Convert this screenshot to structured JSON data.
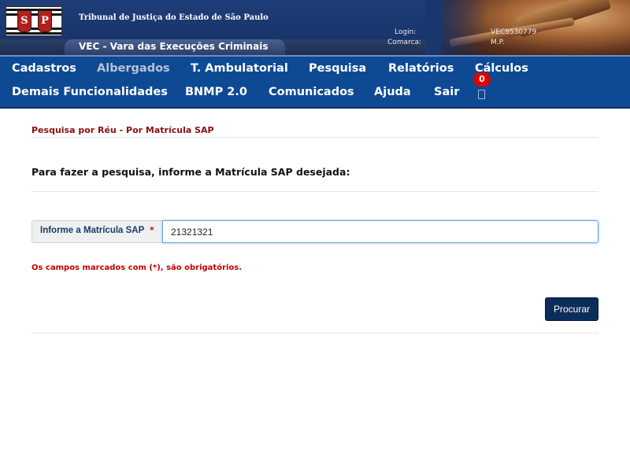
{
  "header": {
    "court_name": "Tribunal de Justiça do Estado de São Paulo",
    "system_name": "VEC - Vara das Execuções Criminais",
    "login_label": "Login:",
    "login_value": "VEC9530779",
    "comarca_label": "Comarca:",
    "comarca_value": "M.P.",
    "logo_letters": [
      "S",
      "P"
    ]
  },
  "nav": {
    "row1": [
      "Cadastros",
      "Albergados",
      "T. Ambulatorial",
      "Pesquisa",
      "Relatórios",
      "Cálculos"
    ],
    "row2": [
      "Demais Funcionalidades",
      "BNMP 2.0",
      "Comunicados",
      "Ajuda",
      "Sair"
    ],
    "disabled_item": "Albergados",
    "notification_count": "0",
    "notification_icon": "bell-icon"
  },
  "form": {
    "section_title": "Pesquisa por Réu - Por Matrícula SAP",
    "instruction": "Para fazer a pesquisa, informe a Matrícula SAP desejada:",
    "field_label": "Informe a Matrícula SAP",
    "required_marker": "*",
    "field_value": "21321321",
    "required_note": "Os campos marcados com (*), são obrigatórios.",
    "submit_label": "Procurar"
  },
  "colors": {
    "nav_background": "#0e4a93",
    "title_red": "#8b0d0d",
    "button_background": "#0c2d5a",
    "badge_red": "#e00000"
  }
}
